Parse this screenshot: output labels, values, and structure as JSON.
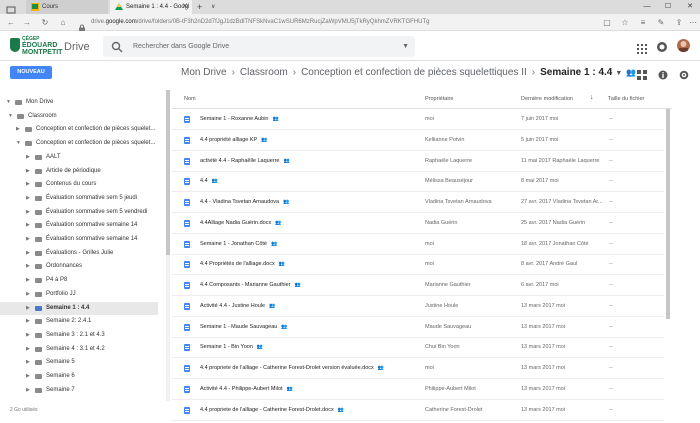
{
  "browser": {
    "tabs": [
      {
        "title": "Cours"
      },
      {
        "title": "Semaine 1 : 4.4 - Googl"
      }
    ],
    "url_prefix": "drive.",
    "url_domain": "google.com",
    "url_path": "/drive/folders/0B-tF3h2nD2d7fJgJ1dzBdlTNFSkNvaC1wSUR6MzRucjZaWpVMU5jTkRyQkhmZVRKTGFHUTg"
  },
  "header": {
    "logo_line1": "CÉGEP",
    "logo_line2": "ÉDOUARD",
    "logo_line3": "MONTPETIT",
    "app_name": "Drive",
    "search_placeholder": "Rechercher dans Google Drive"
  },
  "toolbar": {
    "new_label": "NOUVEAU",
    "breadcrumbs": [
      "Mon Drive",
      "Classroom",
      "Conception et confection de pièces squelettiques II"
    ],
    "current": "Semaine 1 : 4.4"
  },
  "sidebar": {
    "items": [
      {
        "label": "Mon Drive",
        "level": 0,
        "arrow": "▼",
        "folder": "drive"
      },
      {
        "label": "Classroom",
        "level": 1,
        "arrow": "▼"
      },
      {
        "label": "Conception et confection de pièces squelet...",
        "level": 2,
        "arrow": "▶"
      },
      {
        "label": "Conception et confection de pièces squelet...",
        "level": 2,
        "arrow": "▼"
      },
      {
        "label": "AALT",
        "level": 3,
        "arrow": "▶"
      },
      {
        "label": "Article de périodique",
        "level": 3,
        "arrow": "▶"
      },
      {
        "label": "Contenus du cours",
        "level": 3,
        "arrow": "▶"
      },
      {
        "label": "Évaluation sommative sem 5 jeudi",
        "level": 3,
        "arrow": "▶"
      },
      {
        "label": "Évaluation sommative sem 5 vendredi",
        "level": 3,
        "arrow": "▶"
      },
      {
        "label": "Évaluation sommative semaine 14",
        "level": 3,
        "arrow": "▶"
      },
      {
        "label": "Évaluation sommative semaine 14",
        "level": 3,
        "arrow": "▶"
      },
      {
        "label": "Évaluations - Grilles Julie",
        "level": 3,
        "arrow": "▶"
      },
      {
        "label": "Ordonnances",
        "level": 3,
        "arrow": "▶"
      },
      {
        "label": "P4 à P8",
        "level": 3,
        "arrow": "▶"
      },
      {
        "label": "Portfolio JJ",
        "level": 3,
        "arrow": "▶"
      },
      {
        "label": "Semaine 1 : 4.4",
        "level": 3,
        "arrow": "▶",
        "selected": true
      },
      {
        "label": "Semaine 2: 2.4.1",
        "level": 3,
        "arrow": "▶"
      },
      {
        "label": "Semaine 3 : 2.1 et 4.3",
        "level": 3,
        "arrow": "▶"
      },
      {
        "label": "Semaine 4 : 3.1 et 4.2",
        "level": 3,
        "arrow": "▶"
      },
      {
        "label": "Semaine 5",
        "level": 3,
        "arrow": "▶"
      },
      {
        "label": "Semaine 6",
        "level": 3,
        "arrow": "▶"
      },
      {
        "label": "Semaine 7",
        "level": 3,
        "arrow": "▶"
      }
    ],
    "storage": "2 Go utilisés"
  },
  "list": {
    "columns": {
      "name": "Nom",
      "owner": "Propriétaire",
      "modified": "Dernière modification",
      "size": "Taille du fichier"
    },
    "rows": [
      {
        "name": "Semaine 1 - Roxanne Aubin",
        "shared": true,
        "owner": "moi",
        "modified": "7 juin 2017 moi",
        "size": "--"
      },
      {
        "name": "4.4 propriété alliage KP",
        "shared": true,
        "owner": "Kellianne Potvin",
        "modified": "5 juin 2017 moi",
        "size": "--"
      },
      {
        "name": "activité 4.4 - Raphaêlle Laquerre",
        "shared": true,
        "owner": "Raphaële Laquerre",
        "modified": "11 mai 2017 Raphaële Laquerre",
        "size": "--"
      },
      {
        "name": "4.4",
        "shared": true,
        "owner": "Mélissa Beauséjour",
        "modified": "8 mai 2017 moi",
        "size": "--"
      },
      {
        "name": "4.4 - Vladina Tsvetan Arnaudova",
        "shared": true,
        "owner": "Vladina Tsvetan Arnaudova",
        "modified": "27 avr. 2017 Vladina Tsvetan Ar...",
        "size": "--"
      },
      {
        "name": "4.4Alliage Nadia Guérin.docx",
        "shared": true,
        "owner": "Nadia Guérin",
        "modified": "25 avr. 2017 Nadia Guérin",
        "size": "--"
      },
      {
        "name": "Semaine 1 - Jonathan Côté",
        "shared": true,
        "owner": "moi",
        "modified": "18 avr. 2017 Jonathan Côté",
        "size": "--"
      },
      {
        "name": "4.4 Propriétés de l'alliage.docx",
        "shared": true,
        "owner": "moi",
        "modified": "8 avr. 2017 André Gaul",
        "size": "--"
      },
      {
        "name": "4.4 Composants - Marianne Gauthier",
        "shared": true,
        "owner": "Marianne Gauthier",
        "modified": "6 avr. 2017 moi",
        "size": "--"
      },
      {
        "name": "Activité 4.4 - Justine Houle",
        "shared": true,
        "owner": "Justine Houle",
        "modified": "13 mars 2017 moi",
        "size": "--"
      },
      {
        "name": "Semaine 1 - Maude Sauvageau",
        "shared": true,
        "owner": "Maude Sauvageau",
        "modified": "13 mars 2017 moi",
        "size": "--"
      },
      {
        "name": "Semaine 1 - Bin Yoon",
        "shared": true,
        "owner": "Chui Bin Yoon",
        "modified": "13 mars 2017 moi",
        "size": "--"
      },
      {
        "name": "4.4 propriete de l'alliage - Catherine Forest-Drolet version évaluée.docx",
        "shared": true,
        "owner": "moi",
        "modified": "13 mars 2017 moi",
        "size": "--"
      },
      {
        "name": "Activité 4.4 - Philippe-Aubert Milot",
        "shared": true,
        "owner": "Philippe-Aubert Milot",
        "modified": "13 mars 2017 moi",
        "size": "--"
      },
      {
        "name": "4.4 propriete de l'alliage - Catherine Forest-Drolet.docx",
        "shared": true,
        "owner": "Catherine Forest-Drolet",
        "modified": "13 mars 2017 moi",
        "size": "--"
      }
    ]
  },
  "colors": {
    "accent": "#4285f4",
    "brand": "#1a7a4a"
  }
}
